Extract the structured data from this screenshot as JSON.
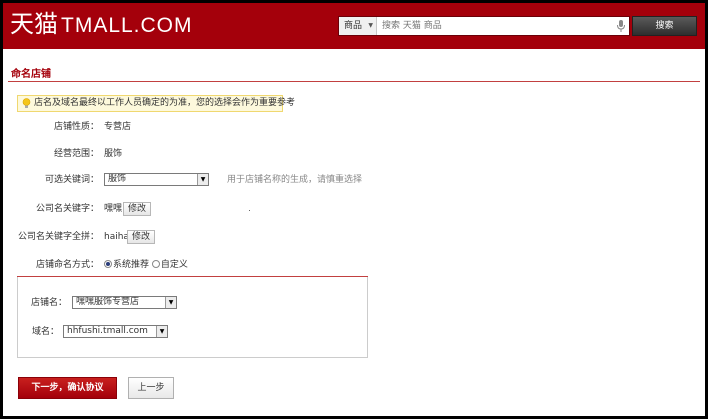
{
  "header": {
    "logo_cn": "天猫",
    "logo_en": "TMALL.COM",
    "search_scope": "商品",
    "search_placeholder": "搜索 天猫 商品",
    "search_button": "搜索"
  },
  "page": {
    "title": "命名店铺",
    "notice": "店名及域名最终以工作人员确定的为准，您的选择会作为重要参考"
  },
  "form": {
    "store_type": {
      "label": "店铺性质：",
      "value": "专营店"
    },
    "business_scope": {
      "label": "经营范围：",
      "value": "服饰"
    },
    "keyword": {
      "label": "可选关键词：",
      "value": "服饰",
      "hint": "用于店铺名称的生成，请慎重选择"
    },
    "company_keyword": {
      "label": "公司名关键字：",
      "value": "嘿嘿",
      "edit": "修改"
    },
    "company_pinyin": {
      "label": "公司名关键字全拼：",
      "value": "haihai",
      "edit": "修改"
    },
    "naming_mode": {
      "label": "店铺命名方式：",
      "options": [
        "系统推荐",
        "自定义"
      ],
      "selected": "系统推荐"
    },
    "store_name": {
      "label": "店铺名：",
      "value": "嘿嘿服饰专营店"
    },
    "domain": {
      "label": "域名：",
      "value": "hhfushi.tmall.com"
    }
  },
  "actions": {
    "next": "下一步，确认协议",
    "prev": "上一步"
  },
  "colors": {
    "brand_red": "#a4000b",
    "notice_bg": "#fdf9dc"
  }
}
